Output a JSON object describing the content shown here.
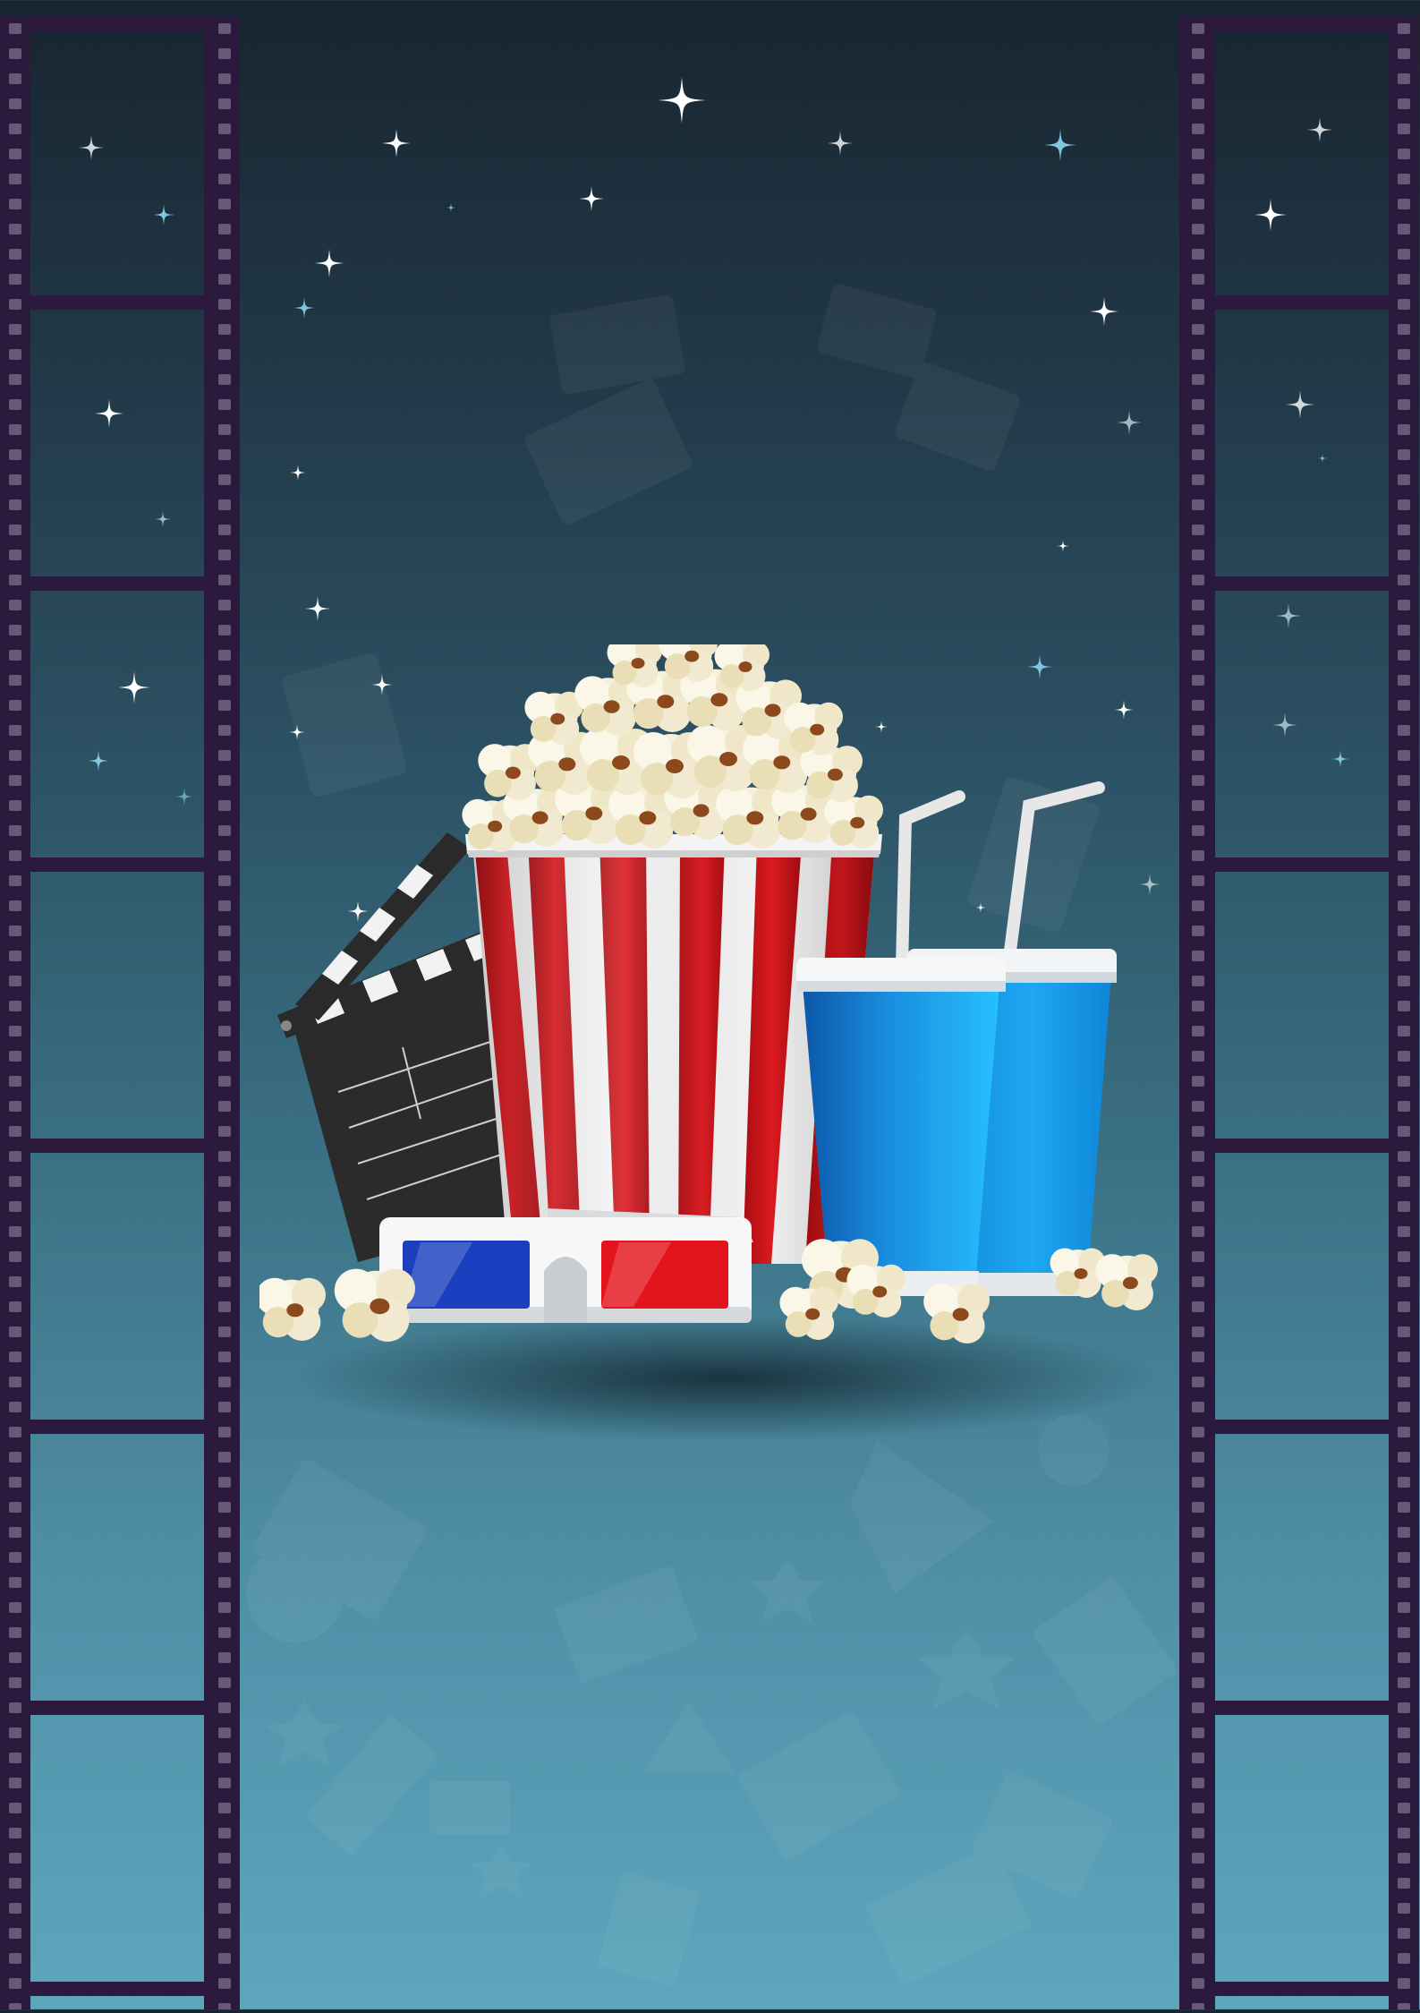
{
  "poster": {
    "theme": "cinema",
    "colors": {
      "background_top": "#182530",
      "background_bottom": "#5ea6bc",
      "filmstrip": "#2b1a3e",
      "popcorn_red": "#d0151c",
      "cup_blue": "#1a8fe0",
      "glasses_blue": "#1c3fbf",
      "glasses_red": "#e3141b"
    },
    "icons": [
      "filmstrip-icon",
      "star-icon",
      "popcorn-bucket-icon",
      "clapperboard-icon",
      "soda-cup-icon",
      "3d-glasses-icon",
      "popcorn-kernel-icon"
    ]
  }
}
